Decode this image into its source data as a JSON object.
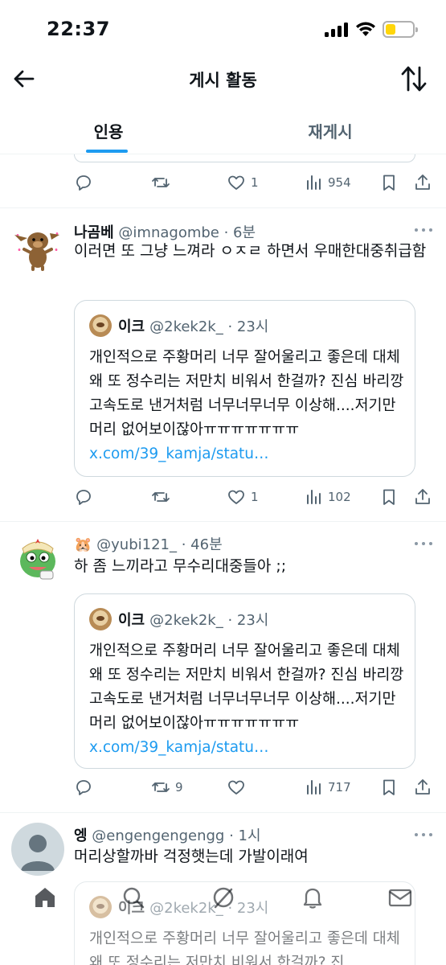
{
  "status_bar": {
    "time": "22:37"
  },
  "header": {
    "title": "게시 활동"
  },
  "tabs": [
    {
      "label": "인용",
      "active": true
    },
    {
      "label": "재게시",
      "active": false
    }
  ],
  "top_partial_actions": {
    "replies": "",
    "reposts": "",
    "likes": "1",
    "views": "954"
  },
  "tweets": [
    {
      "name": "나곰베",
      "handle": "@imnagombe · 6분",
      "text": "이러면 또 그냥 느껴라 ㅇㅈㄹ 하면서 우매한대중취급함",
      "quote": {
        "name": "이크",
        "handle": "@2kek2k_ · 23시",
        "text": "개인적으로 주황머리 너무 잘어울리고 좋은데 대체 왜 또 정수리는 저만치 비워서 한걸까? 진심 바리깡 고속도로 낸거처럼 너무너무너무 이상해....저기만 머리 없어보이잖아ㅠㅠㅠㅠㅠㅠㅠ",
        "link": "x.com/39_kamja/statu…"
      },
      "actions": {
        "replies": "",
        "reposts": "",
        "likes": "1",
        "views": "102"
      }
    },
    {
      "name": "",
      "handle": "@yubi121_ · 46분",
      "text": "하 좀 느끼라고 무수리대중들아 ;;",
      "quote": {
        "name": "이크",
        "handle": "@2kek2k_ · 23시",
        "text": "개인적으로 주황머리 너무 잘어울리고 좋은데 대체 왜 또 정수리는 저만치 비워서 한걸까? 진심 바리깡 고속도로 낸거처럼 너무너무너무 이상해....저기만 머리 없어보이잖아ㅠㅠㅠㅠㅠㅠㅠ",
        "link": "x.com/39_kamja/statu…"
      },
      "actions": {
        "replies": "",
        "reposts": "9",
        "likes": "",
        "views": "717"
      }
    },
    {
      "name": "엥",
      "handle": "@engengengengg · 1시",
      "text": "머리상할까바 걱정햇는데 가발이래여",
      "quote": {
        "name": "이크",
        "handle": "@2kek2k_ · 23시",
        "text": "개인적으로 주황머리 너무 잘어울리고 좋은데 대체 왜 또 정수리는 저만치 비워서 한걸까? 진"
      }
    }
  ],
  "colors": {
    "accent": "#1d9bf0",
    "text": "#0f1419",
    "muted": "#536471"
  },
  "icons": [
    "back-arrow-icon",
    "sort-icon",
    "reply-icon",
    "repost-icon",
    "like-icon",
    "views-icon",
    "bookmark-icon",
    "share-icon",
    "home-icon",
    "search-icon",
    "grok-icon",
    "bell-icon",
    "mail-icon"
  ]
}
